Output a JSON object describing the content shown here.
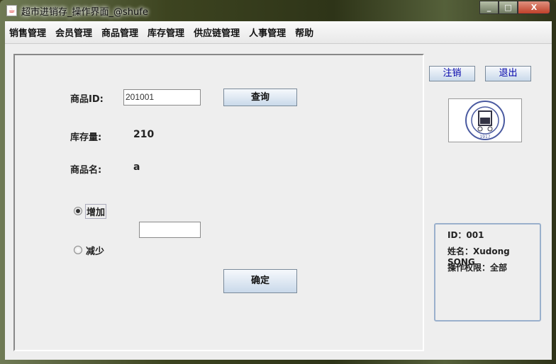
{
  "window": {
    "title": "超市进销存_操作界面_@shufe",
    "minimize": "_",
    "maximize": "□",
    "close": "X"
  },
  "menu": [
    "销售管理",
    "会员管理",
    "商品管理",
    "库存管理",
    "供应链管理",
    "人事管理",
    "帮助"
  ],
  "form": {
    "id_label": "商品ID:",
    "id_value": "201001",
    "query_button": "查询",
    "stock_label": "库存量:",
    "stock_value": "210",
    "name_label": "商品名:",
    "name_value": "a",
    "increase_label": "增加",
    "decrease_label": "减少",
    "selected": "increase",
    "amount_value": "",
    "confirm_button": "确定"
  },
  "side": {
    "logout_button": "注销",
    "exit_button": "退出",
    "logo_text": "1917",
    "user_id": "ID：001",
    "user_name": "姓名：Xudong SONG",
    "permission": "操作权限：全部"
  }
}
